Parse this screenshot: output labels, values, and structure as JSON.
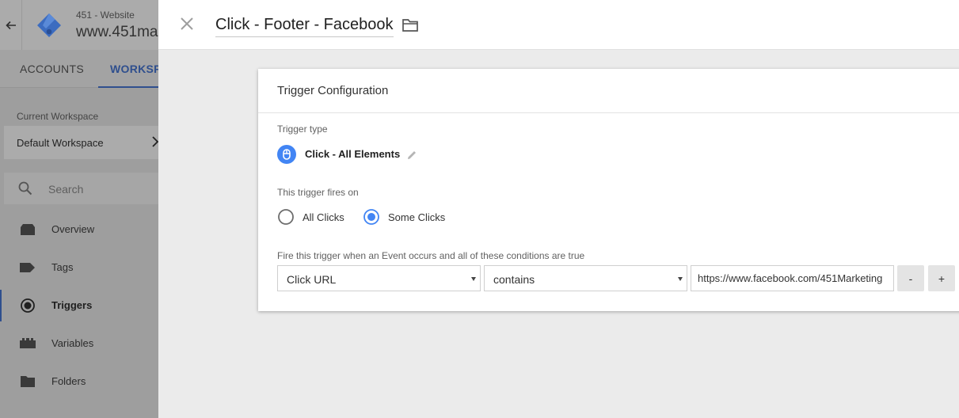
{
  "app": {
    "account_name": "451 - Website",
    "container_name": "www.451ma"
  },
  "tabs": [
    {
      "label": "ACCOUNTS"
    },
    {
      "label": "WORKSPA"
    }
  ],
  "sidebar": {
    "current_workspace_label": "Current Workspace",
    "workspace_name": "Default Workspace",
    "search_placeholder": "Search",
    "items": [
      {
        "label": "Overview",
        "icon": "overview-icon"
      },
      {
        "label": "Tags",
        "icon": "tag-icon"
      },
      {
        "label": "Triggers",
        "icon": "trigger-icon",
        "active": true
      },
      {
        "label": "Variables",
        "icon": "variable-icon"
      },
      {
        "label": "Folders",
        "icon": "folder-icon"
      }
    ]
  },
  "panel": {
    "title": "Click - Footer - Facebook",
    "config": {
      "heading": "Trigger Configuration",
      "trigger_type_label": "Trigger type",
      "trigger_type_name": "Click - All Elements",
      "fires_on_label": "This trigger fires on",
      "fires_on_options": [
        {
          "label": "All Clicks",
          "selected": false
        },
        {
          "label": "Some Clicks",
          "selected": true
        }
      ],
      "conditions_label": "Fire this trigger when an Event occurs and all of these conditions are true",
      "condition": {
        "variable": "Click URL",
        "operator": "contains",
        "value": "https://www.facebook.com/451Marketing"
      },
      "remove_label": "-",
      "add_label": "+"
    }
  },
  "colors": {
    "accent": "#4285f4",
    "dim_accent": "#2f4f8e",
    "panel_bg": "#ebebeb",
    "overlay_bg": "#9e9e9e"
  }
}
